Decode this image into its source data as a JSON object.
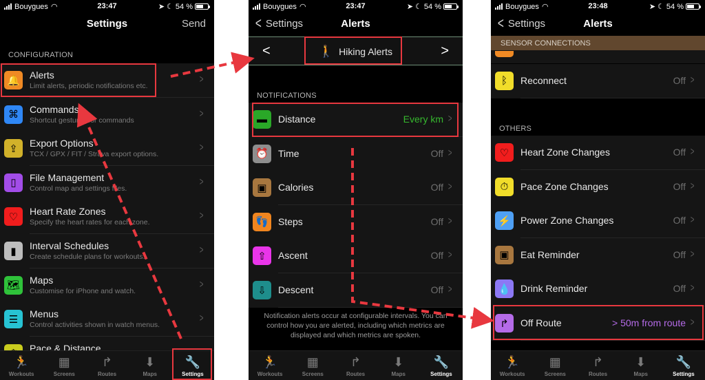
{
  "status_bars": [
    {
      "carrier": "Bouygues",
      "time": "23:47",
      "battery": "54 %",
      "battery_level": 0.54
    },
    {
      "carrier": "Bouygues",
      "time": "23:47",
      "battery": "54 %",
      "battery_level": 0.54
    },
    {
      "carrier": "Bouygues",
      "time": "23:48",
      "battery": "54 %",
      "battery_level": 0.54
    }
  ],
  "screen1": {
    "title": "Settings",
    "send_label": "Send",
    "section": "CONFIGURATION",
    "items": [
      {
        "label": "Alerts",
        "sub": "Limit alerts, periodic notifications etc.",
        "icon": "bell-icon",
        "glyph": "🔔",
        "color": "#f08a24"
      },
      {
        "label": "Commands",
        "sub": "Shortcut gestures for commands",
        "icon": "command-icon",
        "glyph": "⌘",
        "color": "#2f87f5"
      },
      {
        "label": "Export Options",
        "sub": "TCX / GPX / FIT / Strava export options.",
        "icon": "export-icon",
        "glyph": "⇪",
        "color": "#d1b12a"
      },
      {
        "label": "File Management",
        "sub": "Control map and settings files.",
        "icon": "file-icon",
        "glyph": "▯",
        "color": "#a24de8"
      },
      {
        "label": "Heart Rate Zones",
        "sub": "Specify the heart rates for each zone.",
        "icon": "heart-icon",
        "glyph": "♡",
        "color": "#f11d1d"
      },
      {
        "label": "Interval Schedules",
        "sub": "Create schedule plans for workouts.",
        "icon": "bar-chart-icon",
        "glyph": "▮",
        "color": "#bdbdbd"
      },
      {
        "label": "Maps",
        "sub": "Customise for iPhone and watch.",
        "icon": "map-icon",
        "glyph": "🗺",
        "color": "#2fc23a"
      },
      {
        "label": "Menus",
        "sub": "Control activities shown in watch menus.",
        "icon": "menu-icon",
        "glyph": "☰",
        "color": "#27c3d3"
      },
      {
        "label": "Pace & Distance",
        "sub": "",
        "icon": "stopwatch-icon",
        "glyph": "⏱",
        "color": "#c9cc1e"
      }
    ]
  },
  "screen2": {
    "back_label": "Settings",
    "title": "Alerts",
    "picker_prev": "<",
    "picker_next": ">",
    "picker_label": "Hiking Alerts",
    "picker_icon_color": "#35e04a",
    "section": "NOTIFICATIONS",
    "items": [
      {
        "label": "Distance",
        "value": "Every km",
        "value_color": "#36b82e",
        "icon": "distance-icon",
        "glyph": "▬",
        "color": "#2aa828"
      },
      {
        "label": "Time",
        "value": "Off",
        "value_color": "#6f6f6f",
        "icon": "alarm-clock-icon",
        "glyph": "⏰",
        "color": "#8e8e8e"
      },
      {
        "label": "Calories",
        "value": "Off",
        "value_color": "#6f6f6f",
        "icon": "scale-icon",
        "glyph": "▣",
        "color": "#a8773f"
      },
      {
        "label": "Steps",
        "value": "Off",
        "value_color": "#6f6f6f",
        "icon": "footprints-icon",
        "glyph": "👣",
        "color": "#f0851f"
      },
      {
        "label": "Ascent",
        "value": "Off",
        "value_color": "#6f6f6f",
        "icon": "arrow-up-icon",
        "glyph": "⇧",
        "color": "#e935e9"
      },
      {
        "label": "Descent",
        "value": "Off",
        "value_color": "#6f6f6f",
        "icon": "arrow-down-icon",
        "glyph": "⇩",
        "color": "#1e8e8c"
      }
    ],
    "footnote": "Notification alerts occur at configurable intervals. You can control how you are alerted, including which metrics are displayed and which metrics are spoken."
  },
  "screen3": {
    "back_label": "Settings",
    "title": "Alerts",
    "section_sensor": "SENSOR CONNECTIONS",
    "sensor_items": [
      {
        "label": "Reconnect",
        "value": "Off",
        "icon": "bluetooth-icon",
        "glyph": "ᛒ",
        "color": "#f1dd2a"
      }
    ],
    "section_others": "OTHERS",
    "other_items": [
      {
        "label": "Heart Zone Changes",
        "value": "Off",
        "value_color": "#6f6f6f",
        "icon": "heart-icon",
        "glyph": "♡",
        "color": "#f11d1d"
      },
      {
        "label": "Pace Zone Changes",
        "value": "Off",
        "value_color": "#6f6f6f",
        "icon": "stopwatch-icon",
        "glyph": "⏱",
        "color": "#f1dd2a"
      },
      {
        "label": "Power Zone Changes",
        "value": "Off",
        "value_color": "#6f6f6f",
        "icon": "power-icon",
        "glyph": "⚡",
        "color": "#4ea0f5"
      },
      {
        "label": "Eat Reminder",
        "value": "Off",
        "value_color": "#6f6f6f",
        "icon": "food-icon",
        "glyph": "▣",
        "color": "#a8773f"
      },
      {
        "label": "Drink Reminder",
        "value": "Off",
        "value_color": "#6f6f6f",
        "icon": "drop-icon",
        "glyph": "💧",
        "color": "#8c78f5"
      },
      {
        "label": "Off Route",
        "value": "> 50m from route",
        "value_color": "#b56be8",
        "icon": "route-icon",
        "glyph": "↱",
        "color": "#b56be8"
      }
    ]
  },
  "tabbar": [
    {
      "label": "Workouts",
      "icon": "running-icon",
      "glyph": "🏃"
    },
    {
      "label": "Screens",
      "icon": "screens-icon",
      "glyph": "▦"
    },
    {
      "label": "Routes",
      "icon": "routes-icon",
      "glyph": "↱"
    },
    {
      "label": "Maps",
      "icon": "maps-download-icon",
      "glyph": "⬇"
    },
    {
      "label": "Settings",
      "icon": "wrench-icon",
      "glyph": "🔧",
      "active": true
    }
  ],
  "annotation_color": "#e8383f"
}
